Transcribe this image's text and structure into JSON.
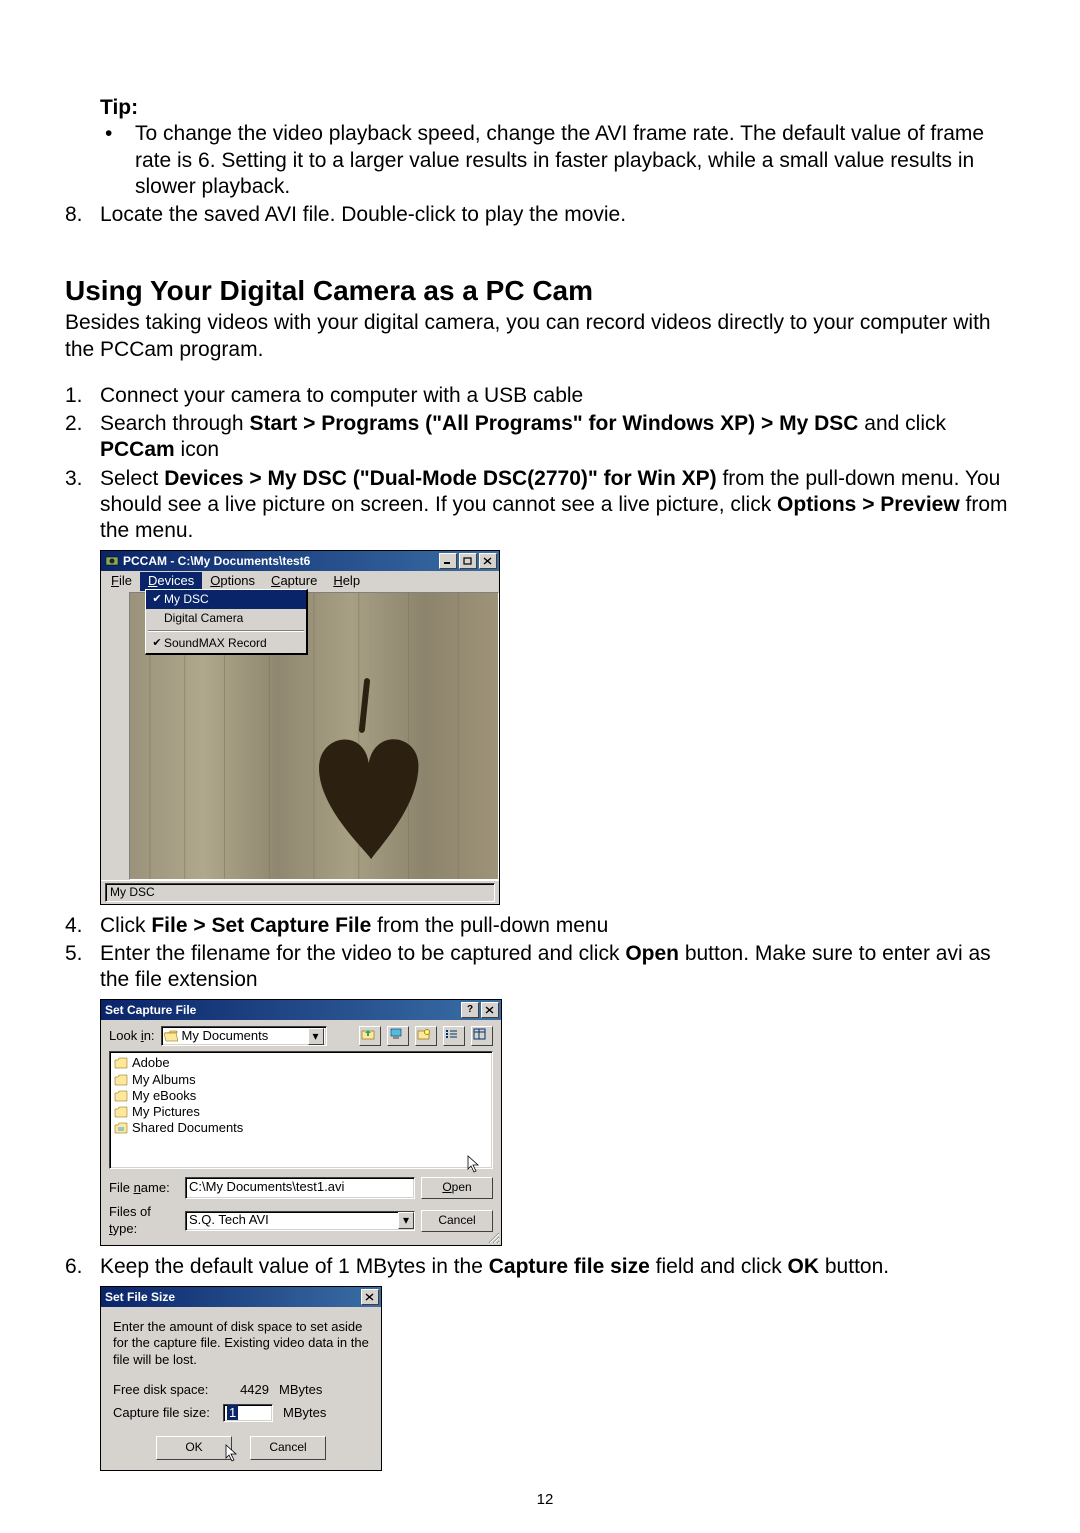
{
  "tip": {
    "label": "Tip:",
    "bullet": "To change the video playback speed, change the AVI frame rate. The default value of frame rate is 6. Setting it to a larger value results in faster playback, while a small value results in slower playback."
  },
  "step8": "Locate the saved AVI file. Double-click to play the movie.",
  "section_title": "Using Your Digital Camera as a PC Cam",
  "intro": "Besides taking videos with your digital camera, you can record videos directly to your computer with the PCCam program.",
  "steps": {
    "s1": "Connect your camera to computer with a USB cable",
    "s2a": "Search through ",
    "s2b_bold": "Start > Programs (\"All Programs\" for Windows XP) > My DSC",
    "s2c": " and click ",
    "s2d_bold": "PCCam",
    "s2e": " icon",
    "s3a": "Select ",
    "s3b_bold": "Devices > My DSC (\"Dual-Mode DSC(2770)\" for Win XP)",
    "s3c": " from the pull-down menu. You should see a live picture on screen. If you cannot see a live picture, click ",
    "s3d_bold": "Options > Preview",
    "s3e": " from the menu.",
    "s4a": "Click ",
    "s4b_bold": "File > Set Capture File",
    "s4c": " from the pull-down menu",
    "s5a": "Enter the filename for the video to be captured and click ",
    "s5b_bold": "Open",
    "s5c": " button. Make sure to enter avi as the file extension",
    "s6a": "Keep the default value of 1 MBytes in the ",
    "s6b_bold": "Capture file size",
    "s6c": " field and click ",
    "s6d_bold": "OK",
    "s6e": " button."
  },
  "pccam": {
    "title": "PCCAM - C:\\My Documents\\test6",
    "menu": {
      "file": "File",
      "devices": "Devices",
      "options": "Options",
      "capture": "Capture",
      "help": "Help"
    },
    "dropdown": {
      "item1": "My DSC",
      "item2": "Digital Camera",
      "item3": "SoundMAX Record"
    },
    "status": "My DSC"
  },
  "capturefile": {
    "title": "Set Capture File",
    "lookin_label": "Look in:",
    "lookin_value": "My Documents",
    "folders": [
      "Adobe",
      "My Albums",
      "My eBooks",
      "My Pictures",
      "Shared Documents"
    ],
    "filename_label": "File name:",
    "filename_value": "C:\\My Documents\\test1.avi",
    "filetype_label": "Files of type:",
    "filetype_value": "S.Q. Tech AVI",
    "open": "Open",
    "cancel": "Cancel"
  },
  "filesize": {
    "title": "Set File Size",
    "msg": "Enter the amount of disk space to set aside for the capture file.  Existing video data in the file will be lost.",
    "free_label": "Free disk space:",
    "free_value": "4429",
    "mbytes": "MBytes",
    "cap_label": "Capture file size:",
    "cap_value": "1",
    "ok": "OK",
    "cancel": "Cancel"
  },
  "page_number": "12"
}
